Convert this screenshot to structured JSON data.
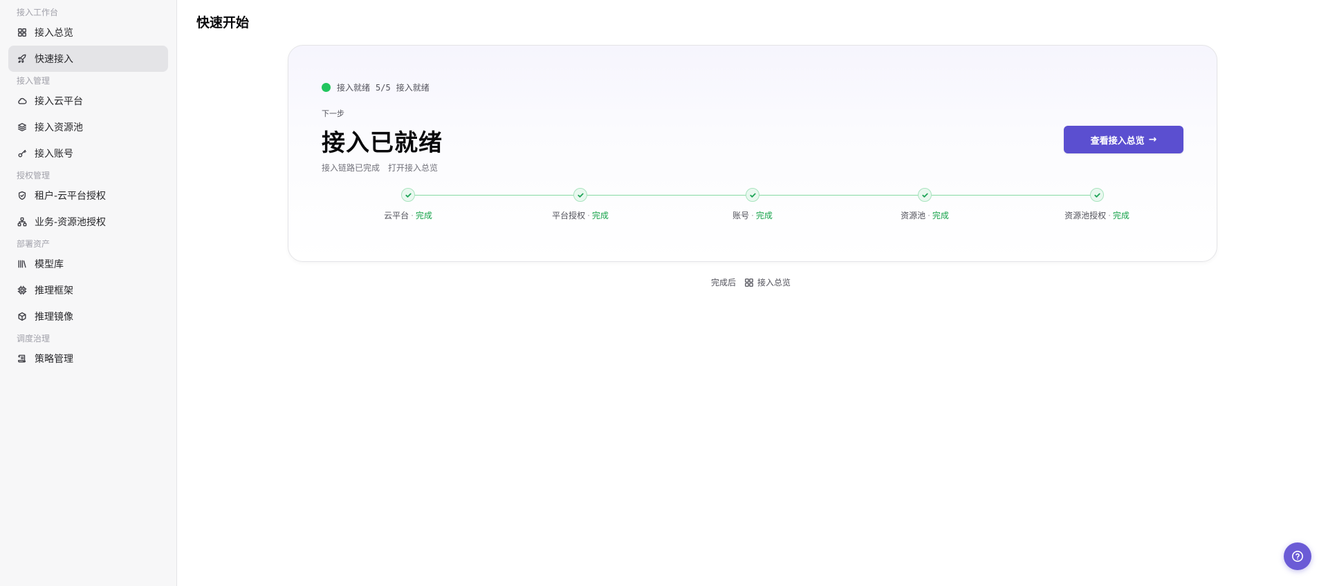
{
  "sidebar": {
    "sections": [
      {
        "label": "接入工作台",
        "items": [
          {
            "label": "接入总览",
            "icon": "grid-icon"
          },
          {
            "label": "快速接入",
            "icon": "rocket-icon",
            "active": true
          }
        ]
      },
      {
        "label": "接入管理",
        "items": [
          {
            "label": "接入云平台",
            "icon": "cloud-icon"
          },
          {
            "label": "接入资源池",
            "icon": "layers-icon"
          },
          {
            "label": "接入账号",
            "icon": "key-icon"
          }
        ]
      },
      {
        "label": "授权管理",
        "items": [
          {
            "label": "租户-云平台授权",
            "icon": "shield-check-icon"
          },
          {
            "label": "业务-资源池授权",
            "icon": "network-icon"
          }
        ]
      },
      {
        "label": "部署资产",
        "items": [
          {
            "label": "模型库",
            "icon": "library-icon"
          },
          {
            "label": "推理框架",
            "icon": "cpu-icon"
          },
          {
            "label": "推理镜像",
            "icon": "box-icon"
          }
        ]
      },
      {
        "label": "调度治理",
        "items": [
          {
            "label": "策略管理",
            "icon": "scroll-icon"
          }
        ]
      }
    ]
  },
  "main": {
    "title": "快速开始",
    "card": {
      "status_text": "接入就绪",
      "progress": "5/5",
      "status_text2": "接入就绪",
      "next_label": "下一步",
      "hero_title": "接入已就绪",
      "sub_text": "接入链路已完成",
      "sub_link": "打开接入总览",
      "cta_label": "查看接入总览",
      "steps": [
        {
          "label": "云平台",
          "state": "完成"
        },
        {
          "label": "平台授权",
          "state": "完成"
        },
        {
          "label": "账号",
          "state": "完成"
        },
        {
          "label": "资源池",
          "state": "完成"
        },
        {
          "label": "资源池授权",
          "state": "完成"
        }
      ]
    },
    "footer": {
      "prefix": "完成后",
      "link_label": "接入总览"
    }
  },
  "colors": {
    "accent": "#5b4fd0",
    "success": "#22c55e",
    "success_text": "#16a34a"
  }
}
